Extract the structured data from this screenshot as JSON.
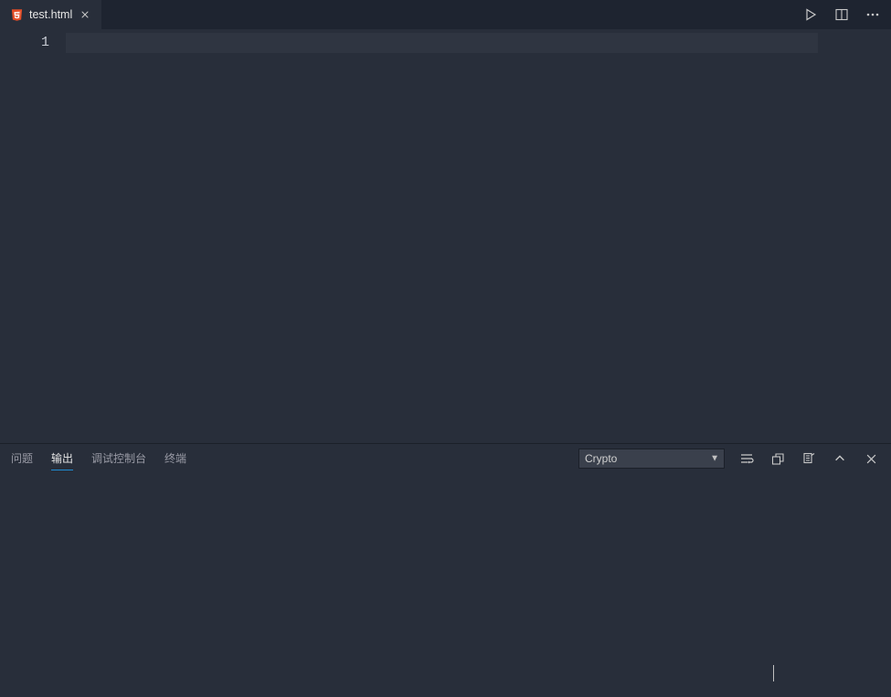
{
  "tabs": [
    {
      "label": "test.html",
      "icon": "html5-icon",
      "active": true,
      "dirty": false
    }
  ],
  "editor": {
    "gutter_start": 1,
    "line_numbers": [
      "1"
    ],
    "current_line_index": 0
  },
  "editor_actions": {
    "run_tooltip": "Run",
    "split_tooltip": "Split Editor",
    "more_tooltip": "More Actions"
  },
  "panel": {
    "tabs": [
      {
        "id": "problems",
        "label": "问题",
        "active": false
      },
      {
        "id": "output",
        "label": "输出",
        "active": true
      },
      {
        "id": "debug",
        "label": "调试控制台",
        "active": false
      },
      {
        "id": "terminal",
        "label": "终端",
        "active": false
      }
    ],
    "output_channel_selected": "Crypto",
    "actions": {
      "toggle_wordwrap": "Toggle Word Wrap",
      "open_log": "Open Log File",
      "clear": "Clear Output",
      "collapse": "Collapse Panel",
      "close": "Close Panel"
    }
  }
}
